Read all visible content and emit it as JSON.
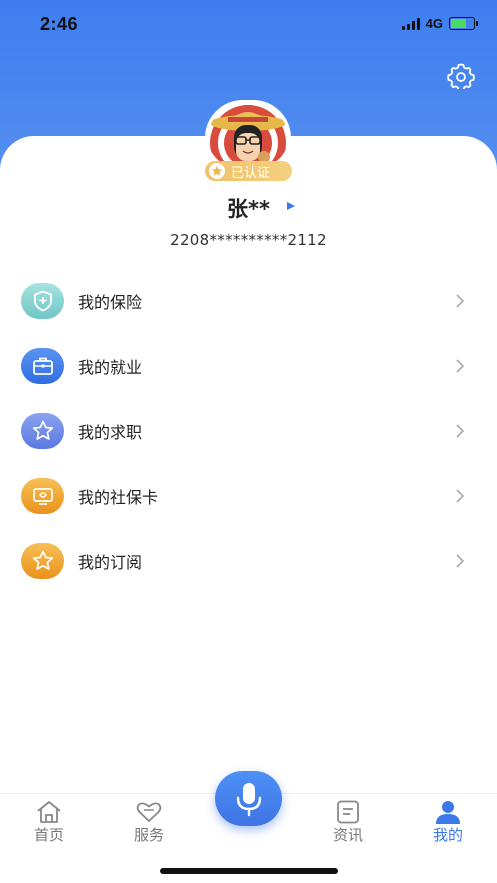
{
  "status_bar": {
    "time": "2:46",
    "network": "4G"
  },
  "profile": {
    "badge": "已认证",
    "name": "张**",
    "id_number": "2208**********2112"
  },
  "menu": [
    {
      "label": "我的保险",
      "icon": "shield-plus-icon",
      "color": "#7fcfcf"
    },
    {
      "label": "我的就业",
      "icon": "briefcase-icon",
      "color": "#3b79ea"
    },
    {
      "label": "我的求职",
      "icon": "star-icon",
      "color": "#6b86e8"
    },
    {
      "label": "我的社保卡",
      "icon": "card-icon",
      "color": "#f0a52a"
    },
    {
      "label": "我的订阅",
      "icon": "star-icon",
      "color": "#f0a52a"
    }
  ],
  "tab_bar": {
    "tabs": [
      {
        "label": "首页",
        "icon": "home-icon"
      },
      {
        "label": "服务",
        "icon": "heart-icon"
      },
      {
        "label": "资讯",
        "icon": "news-icon"
      },
      {
        "label": "我的",
        "icon": "person-icon",
        "active": true
      }
    ],
    "center": {
      "icon": "microphone-icon"
    }
  },
  "colors": {
    "accent": "#3b79ea",
    "header": "#4b88ef",
    "badge": "#f1c36a"
  }
}
